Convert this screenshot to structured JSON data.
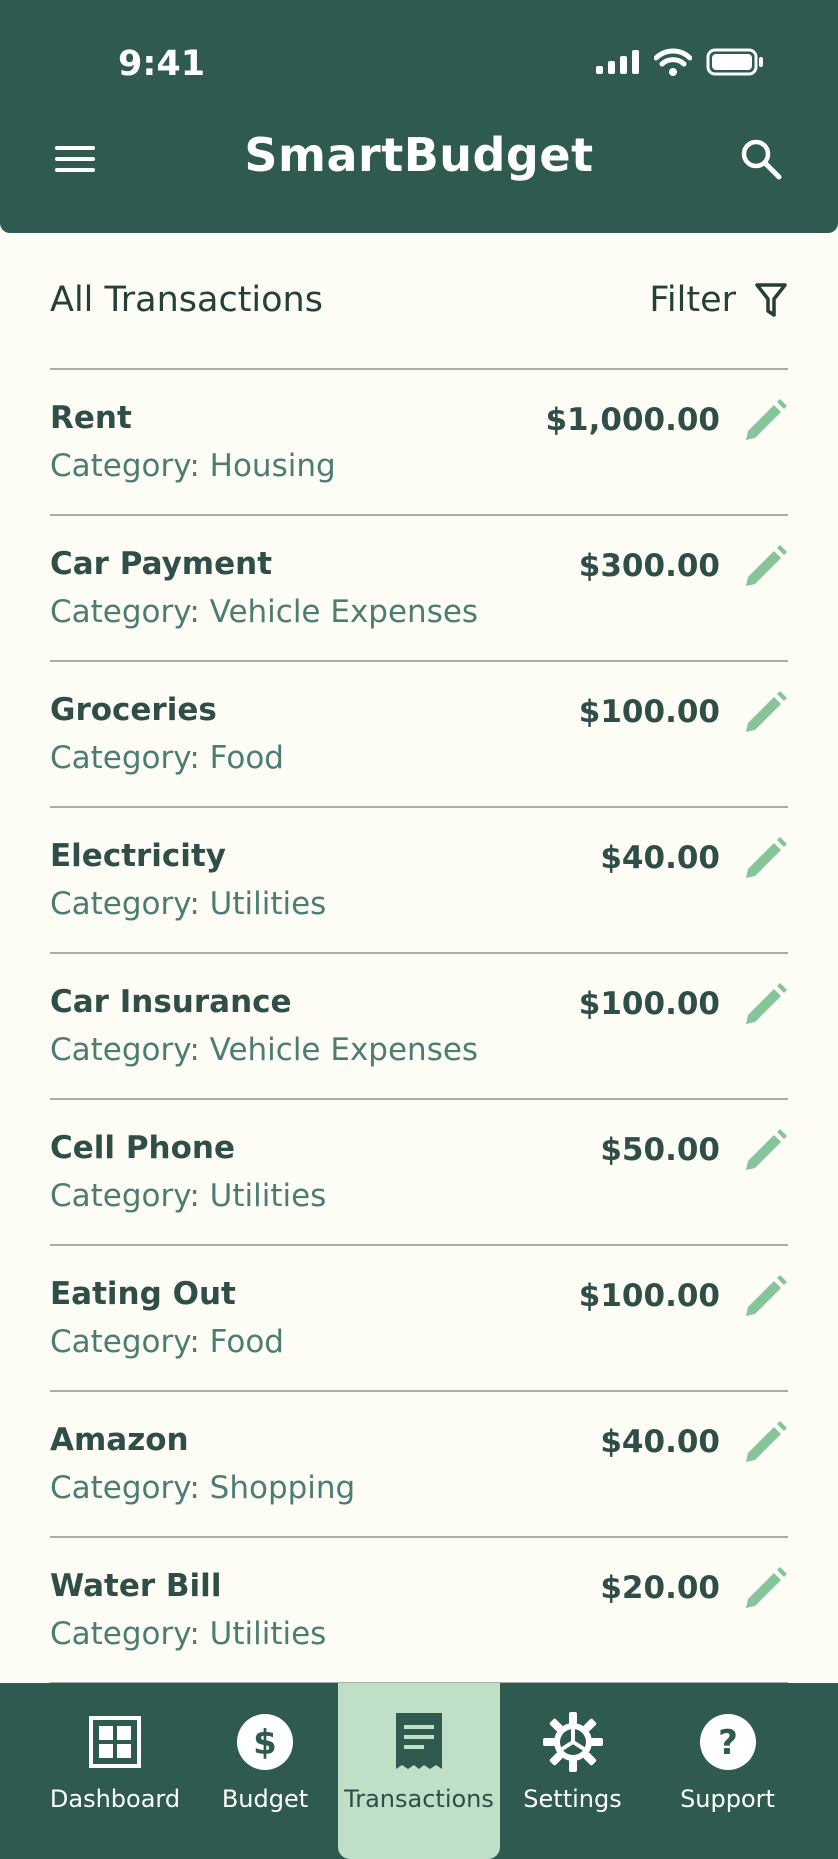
{
  "status_bar": {
    "time": "9:41"
  },
  "header": {
    "title": "SmartBudget"
  },
  "list": {
    "title": "All Transactions",
    "filter_label": "Filter"
  },
  "transactions": [
    {
      "name": "Rent",
      "category": "Category: Housing",
      "amount": "$1,000.00"
    },
    {
      "name": "Car Payment",
      "category": "Category: Vehicle Expenses",
      "amount": "$300.00"
    },
    {
      "name": "Groceries",
      "category": "Category: Food",
      "amount": "$100.00"
    },
    {
      "name": "Electricity",
      "category": "Category: Utilities",
      "amount": "$40.00"
    },
    {
      "name": "Car Insurance",
      "category": "Category: Vehicle Expenses",
      "amount": "$100.00"
    },
    {
      "name": "Cell Phone",
      "category": "Category: Utilities",
      "amount": "$50.00"
    },
    {
      "name": "Eating Out",
      "category": "Category: Food",
      "amount": "$100.00"
    },
    {
      "name": "Amazon",
      "category": "Category: Shopping",
      "amount": "$40.00"
    },
    {
      "name": "Water Bill",
      "category": "Category: Utilities",
      "amount": "$20.00"
    }
  ],
  "nav": [
    {
      "label": "Dashboard",
      "icon": "dashboard-icon",
      "active": false
    },
    {
      "label": "Budget",
      "icon": "dollar-icon",
      "active": false
    },
    {
      "label": "Transactions",
      "icon": "receipt-icon",
      "active": true
    },
    {
      "label": "Settings",
      "icon": "gear-icon",
      "active": false
    },
    {
      "label": "Support",
      "icon": "help-icon",
      "active": false
    }
  ],
  "colors": {
    "header_bg": "#2f5a50",
    "page_bg": "#fdfdf5",
    "edit_icon": "#86c49a",
    "active_tab_bg": "#bfe0c7"
  }
}
